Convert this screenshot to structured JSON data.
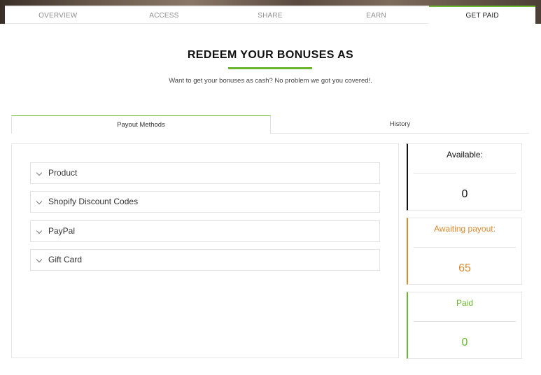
{
  "nav": {
    "tabs": [
      {
        "label": "OVERVIEW"
      },
      {
        "label": "ACCESS"
      },
      {
        "label": "SHARE"
      },
      {
        "label": "EARN"
      },
      {
        "label": "GET PAID",
        "active": true
      }
    ]
  },
  "header": {
    "title": "REDEEM YOUR BONUSES AS",
    "subtitle": "Want to get your bonuses as cash? No problem we got you covered!."
  },
  "subtabs": [
    {
      "label": "Payout Methods",
      "active": true
    },
    {
      "label": "History"
    }
  ],
  "payout_methods": [
    {
      "label": "Product",
      "icon": "chevron-down-icon"
    },
    {
      "label": "Shopify Discount Codes",
      "icon": "chevron-down-icon"
    },
    {
      "label": "PayPal",
      "icon": "chevron-down-icon"
    },
    {
      "label": "Gift Card",
      "icon": "chevron-down-icon"
    }
  ],
  "stats": {
    "available": {
      "label": "Available:",
      "value": "0",
      "color": "#111111"
    },
    "awaiting": {
      "label": "Awaiting payout:",
      "value": "65",
      "color": "#e08a2e"
    },
    "paid": {
      "label": "Paid",
      "value": "0",
      "color": "#6ab72f"
    }
  },
  "colors": {
    "accent": "#6ab72f"
  }
}
